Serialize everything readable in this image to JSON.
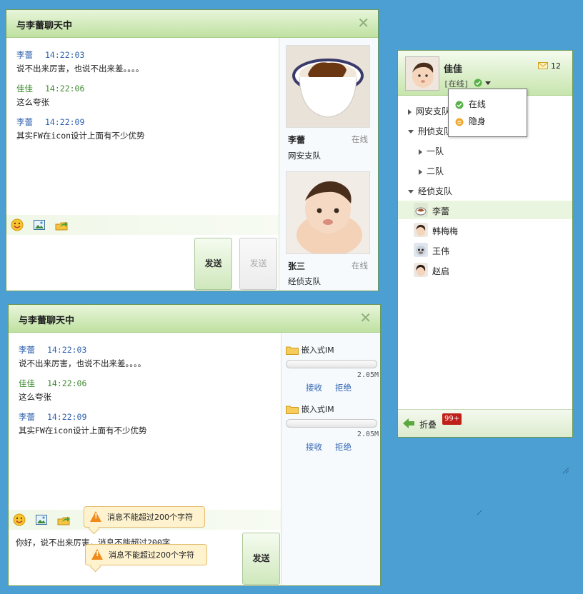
{
  "chat1": {
    "title": "与李蕾聊天中",
    "messages": [
      {
        "name": "李蕾",
        "time": "14:22:03",
        "text": "说不出来厉害，也说不出来差。。。。"
      },
      {
        "name": "佳佳",
        "time": "14:22:06",
        "text": "这么夸张"
      },
      {
        "name": "李蕾",
        "time": "14:22:09",
        "text": "其实FW在icon设计上面有不少优势"
      }
    ],
    "send_label": "发送",
    "send_disabled_label": "发送",
    "contacts": [
      {
        "name": "李蕾",
        "status": "在线",
        "team": "网安支队"
      },
      {
        "name": "张三",
        "status": "在线",
        "team": "经侦支队"
      }
    ]
  },
  "chat2": {
    "title": "与李蕾聊天中",
    "messages": [
      {
        "name": "李蕾",
        "time": "14:22:03",
        "text": "说不出来厉害，也说不出来差。。。。"
      },
      {
        "name": "佳佳",
        "time": "14:22:06",
        "text": "这么夸张"
      },
      {
        "name": "李蕾",
        "time": "14:22:09",
        "text": "其实FW在icon设计上面有不少优势"
      }
    ],
    "input_value": "你好，说不出来厉害，消息不能超过200字",
    "send_label": "发送",
    "warning_text": "消息不能超过200个字符",
    "warning_text_2": "消息不能超过200个字符",
    "files": [
      {
        "name": "嵌入式IM",
        "size": "2.05M",
        "progress": 0,
        "accept": "接收",
        "reject": "拒绝"
      },
      {
        "name": "嵌入式IM",
        "size": "2.05M",
        "progress": 0,
        "accept": "接收",
        "reject": "拒绝"
      }
    ]
  },
  "contacts_panel": {
    "user_name": "佳佳",
    "status_label": "[在线]",
    "mail_count": "12",
    "status_menu": [
      "在线",
      "隐身"
    ],
    "groups": [
      {
        "name": "网安支队",
        "expanded": false
      },
      {
        "name": "刑侦支队",
        "expanded": true
      },
      {
        "name": "一队",
        "expanded": false
      },
      {
        "name": "二队",
        "expanded": false
      },
      {
        "name": "经侦支队",
        "expanded": true
      }
    ],
    "members": [
      "李蕾",
      "韩梅梅",
      "王伟",
      "赵启"
    ],
    "collapse_label": "折叠",
    "unread_badge": "99+"
  },
  "colors": {
    "background": "#4c9fd2",
    "name_blue": "#2f62b0",
    "name_green": "#3d8a2e"
  }
}
